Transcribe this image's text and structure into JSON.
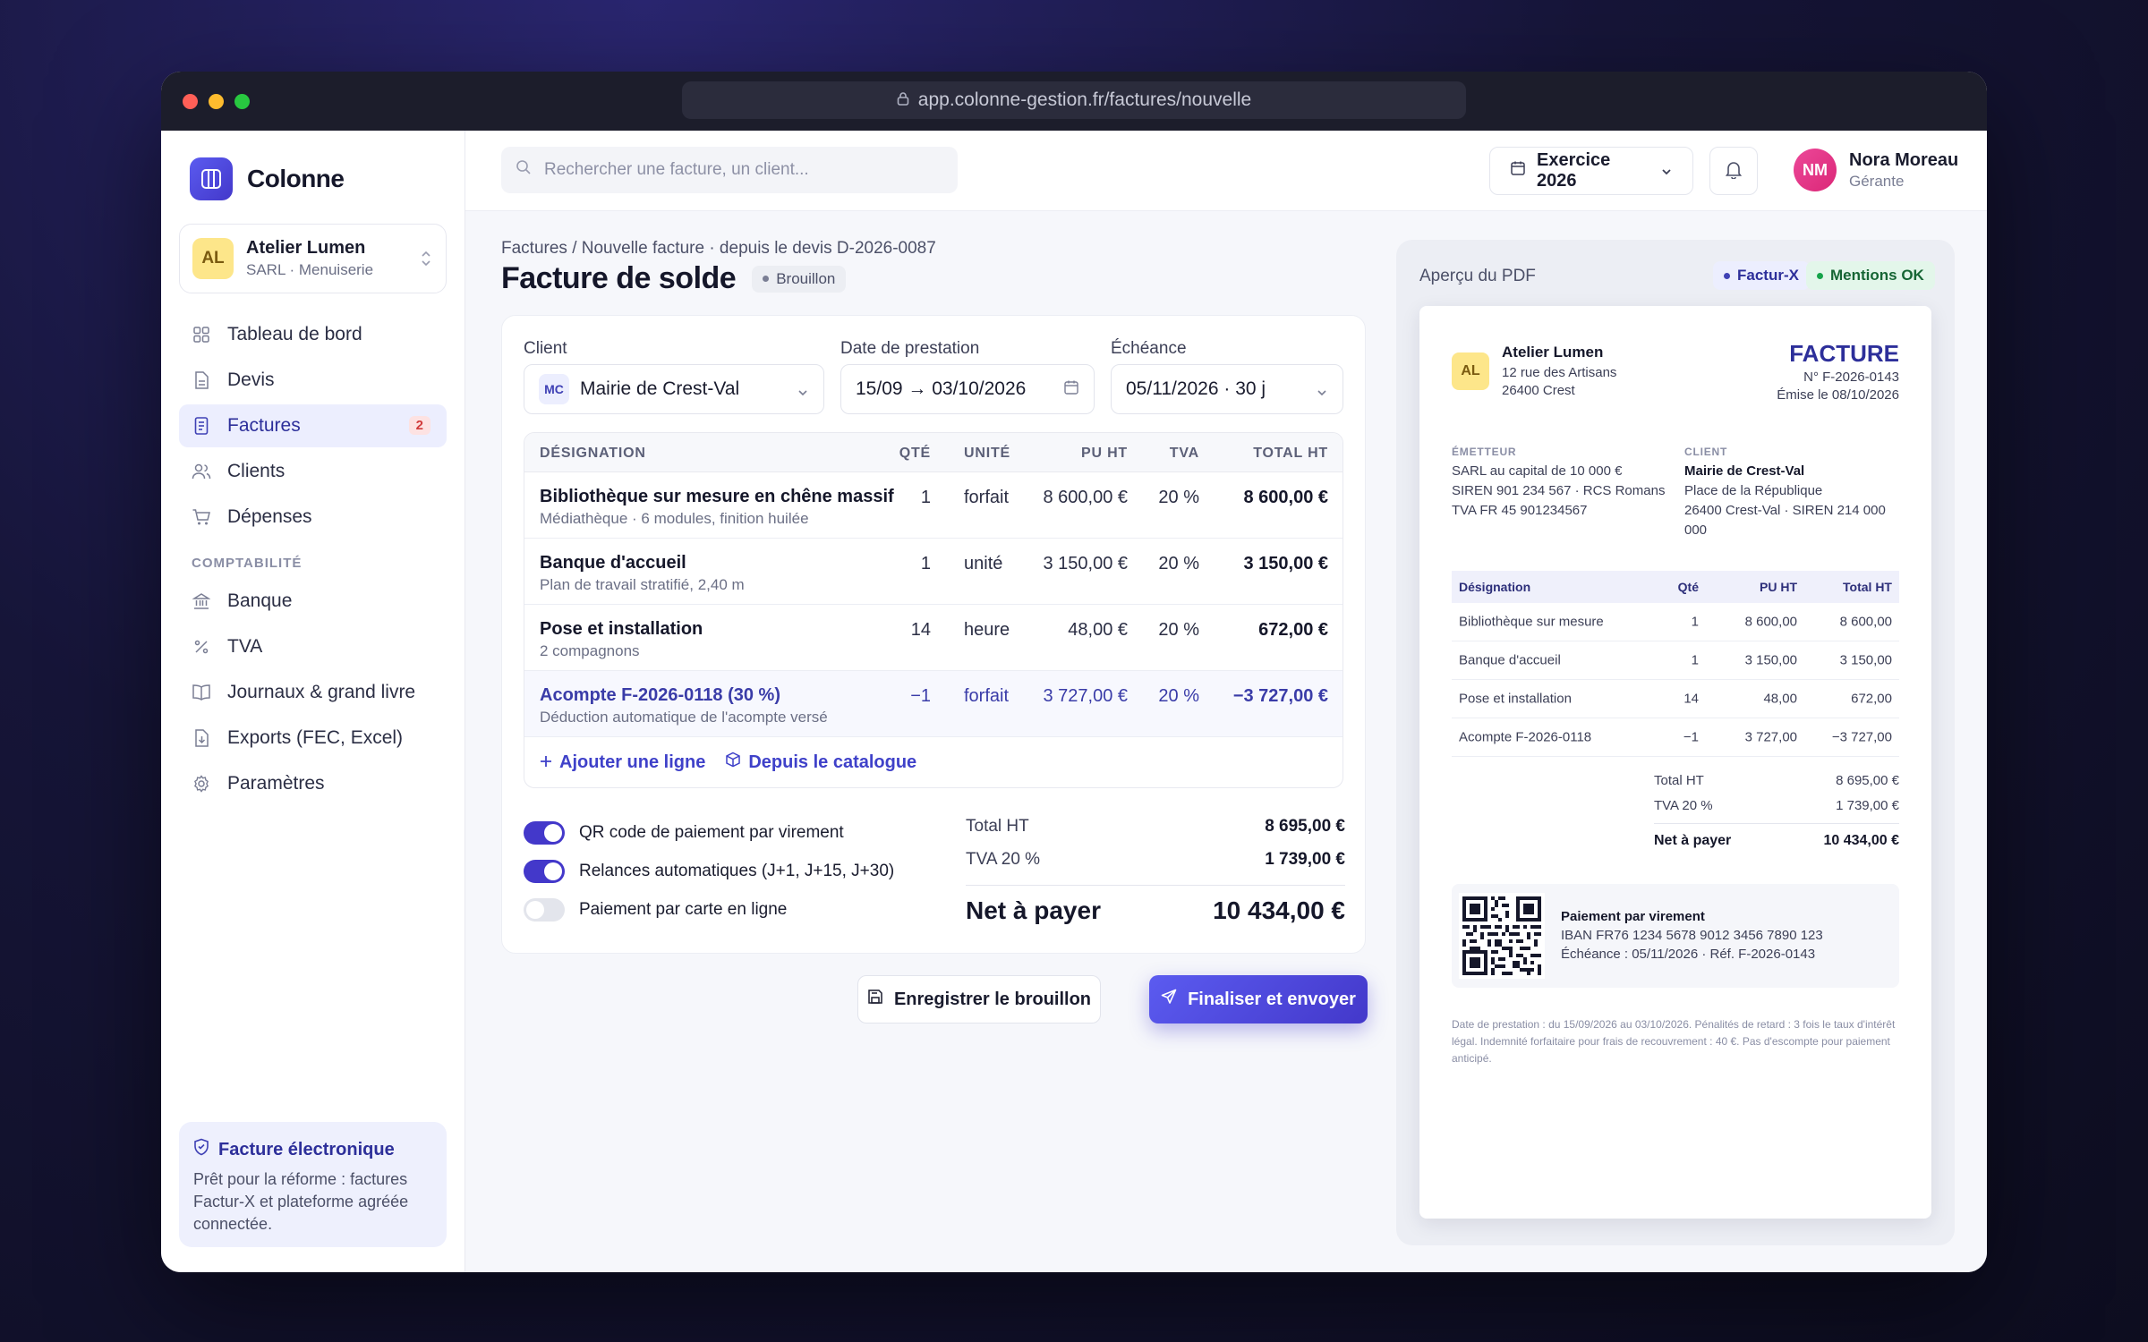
{
  "browser": {
    "url": "app.colonne-gestion.fr/factures/nouvelle"
  },
  "colors": {
    "accent": "#4338ca",
    "accent_light": "#eceefe",
    "badge_red": "#d13b3b",
    "ok_green": "#16a34a"
  },
  "sidebar": {
    "brand": "Colonne",
    "org": {
      "initials": "AL",
      "name": "Atelier Lumen",
      "sub": "SARL · Menuiserie"
    },
    "items": [
      {
        "label": "Tableau de bord",
        "icon": "grid-icon"
      },
      {
        "label": "Devis",
        "icon": "document-icon"
      },
      {
        "label": "Factures",
        "icon": "invoice-icon",
        "badge": "2",
        "active": true
      },
      {
        "label": "Clients",
        "icon": "users-icon"
      },
      {
        "label": "Dépenses",
        "icon": "cart-icon"
      }
    ],
    "section": "COMPTABILITÉ",
    "items2": [
      {
        "label": "Banque",
        "icon": "bank-icon"
      },
      {
        "label": "TVA",
        "icon": "percent-icon"
      },
      {
        "label": "Journaux & grand livre",
        "icon": "book-icon"
      },
      {
        "label": "Exports (FEC, Excel)",
        "icon": "export-icon"
      },
      {
        "label": "Paramètres",
        "icon": "gear-icon"
      }
    ],
    "einvoice": {
      "title": "Facture électronique",
      "text": "Prêt pour la réforme : factures Factur-X et plateforme agréée connectée."
    }
  },
  "topbar": {
    "search_placeholder": "Rechercher une facture, un client...",
    "exercice": "Exercice 2026",
    "user": {
      "initials": "NM",
      "name": "Nora Moreau",
      "role": "Gérante"
    }
  },
  "page": {
    "breadcrumb": "Factures / Nouvelle facture · depuis le devis D-2026-0087",
    "title": "Facture de solde",
    "status": "Brouillon"
  },
  "form": {
    "client_label": "Client",
    "client_initials": "MC",
    "client_value": "Mairie de Crest-Val",
    "date_label": "Date de prestation",
    "date_value": "15/09 → 03/10/2026",
    "due_label": "Échéance",
    "due_value": "05/11/2026 · 30 j"
  },
  "table": {
    "headers": {
      "designation": "DÉSIGNATION",
      "qte": "QTÉ",
      "unite": "UNITÉ",
      "pu": "PU HT",
      "tva": "TVA",
      "total": "TOTAL HT"
    },
    "rows": [
      {
        "designation": "Bibliothèque sur mesure en chêne massif",
        "sub": "Médiathèque · 6 modules, finition huilée",
        "qte": "1",
        "unite": "forfait",
        "pu": "8 600,00 €",
        "tva": "20 %",
        "total": "8 600,00 €"
      },
      {
        "designation": "Banque d'accueil",
        "sub": "Plan de travail stratifié, 2,40 m",
        "qte": "1",
        "unite": "unité",
        "pu": "3 150,00 €",
        "tva": "20 %",
        "total": "3 150,00 €"
      },
      {
        "designation": "Pose et installation",
        "sub": "2 compagnons",
        "qte": "14",
        "unite": "heure",
        "pu": "48,00 €",
        "tva": "20 %",
        "total": "672,00 €"
      },
      {
        "designation": "Acompte F-2026-0118 (30 %)",
        "sub": "Déduction automatique de l'acompte versé",
        "qte": "−1",
        "unite": "forfait",
        "pu": "3 727,00 €",
        "tva": "20 %",
        "total": "−3 727,00 €"
      }
    ],
    "add_line": "Ajouter une ligne",
    "from_catalog": "Depuis le catalogue"
  },
  "toggles": [
    {
      "label": "QR code de paiement par virement",
      "on": true
    },
    {
      "label": "Relances automatiques (J+1, J+15, J+30)",
      "on": true
    },
    {
      "label": "Paiement par carte en ligne",
      "on": false
    }
  ],
  "totals": {
    "ht_label": "Total HT",
    "ht": "8 695,00 €",
    "tva_label": "TVA 20 %",
    "tva": "1 739,00 €",
    "net_label": "Net à payer",
    "net": "10 434,00 €"
  },
  "actions": {
    "draft": "Enregistrer le brouillon",
    "send": "Finaliser et envoyer"
  },
  "preview": {
    "title": "Aperçu du PDF",
    "chip1": "Factur-X",
    "chip2": "Mentions OK",
    "paper": {
      "initials": "AL",
      "company": "Atelier Lumen",
      "addr1": "12 rue des Artisans",
      "addr2": "26400 Crest",
      "doc_title": "FACTURE",
      "doc_number": "N° F-2026-0143",
      "doc_date": "Émise le 08/10/2026",
      "emitter_label": "ÉMETTEUR",
      "emitter_lines": [
        "SARL au capital de 10 000 €",
        "SIREN 901 234 567 · RCS Romans",
        "TVA FR 45 901234567"
      ],
      "client_label": "CLIENT",
      "client_name": "Mairie de Crest-Val",
      "client_lines": [
        "Place de la République",
        "26400 Crest-Val · SIREN 214 000",
        "000"
      ],
      "headers": {
        "des": "Désignation",
        "qte": "Qté",
        "pu": "PU HT",
        "tot": "Total HT"
      },
      "rows": [
        {
          "des": "Bibliothèque sur mesure",
          "qte": "1",
          "pu": "8 600,00",
          "tot": "8 600,00"
        },
        {
          "des": "Banque d'accueil",
          "qte": "1",
          "pu": "3 150,00",
          "tot": "3 150,00"
        },
        {
          "des": "Pose et installation",
          "qte": "14",
          "pu": "48,00",
          "tot": "672,00"
        },
        {
          "des": "Acompte F-2026-0118",
          "qte": "−1",
          "pu": "3 727,00",
          "tot": "−3 727,00"
        }
      ],
      "tot_ht_label": "Total HT",
      "tot_ht": "8 695,00 €",
      "tva_label": "TVA 20 %",
      "tva": "1 739,00 €",
      "net_label": "Net à payer",
      "net": "10 434,00 €",
      "pay_title": "Paiement par virement",
      "pay_iban": "IBAN FR76 1234 5678 9012 3456 7890 123",
      "pay_due": "Échéance : 05/11/2026 · Réf. F-2026-0143",
      "legal": "Date de prestation : du 15/09/2026 au 03/10/2026. Pénalités de retard : 3 fois le taux d'intérêt légal. Indemnité forfaitaire pour frais de recouvrement : 40 €. Pas d'escompte pour paiement anticipé."
    }
  }
}
